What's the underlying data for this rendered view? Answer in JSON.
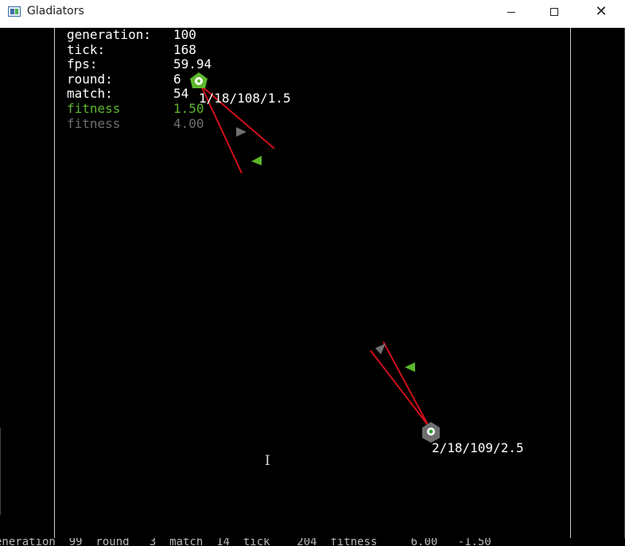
{
  "window": {
    "title": "Gladiators",
    "controls": {
      "minimize": "minimize",
      "maximize": "maximize",
      "close": "✕"
    }
  },
  "stats": {
    "generation": {
      "label": "generation:",
      "value": "100"
    },
    "tick": {
      "label": "tick:",
      "value": "168"
    },
    "fps": {
      "label": "fps:",
      "value": "59.94"
    },
    "round": {
      "label": "round:",
      "value": "6"
    },
    "match": {
      "label": "match:",
      "value": "54"
    },
    "fitness_green": {
      "label": "fitness",
      "value": "1.50"
    },
    "fitness_gray": {
      "label": "fitness",
      "value": "4.00"
    }
  },
  "units": {
    "green_unit_label": "1/18/108/1.5",
    "gray_unit_label": "2/18/109/2.5"
  },
  "bottom_status": "eneration  99  round   3  match  14  tick    204  fitness     6.00   -1.50",
  "colors": {
    "background": "#000000",
    "text": "#ffffff",
    "green": "#5cb82c",
    "gray": "#6f6f6f",
    "ray": "#d0101a",
    "border": "#cfcfcf"
  },
  "icons": {
    "app": "gladiators-app-icon",
    "cursor": "text-cursor-icon"
  }
}
